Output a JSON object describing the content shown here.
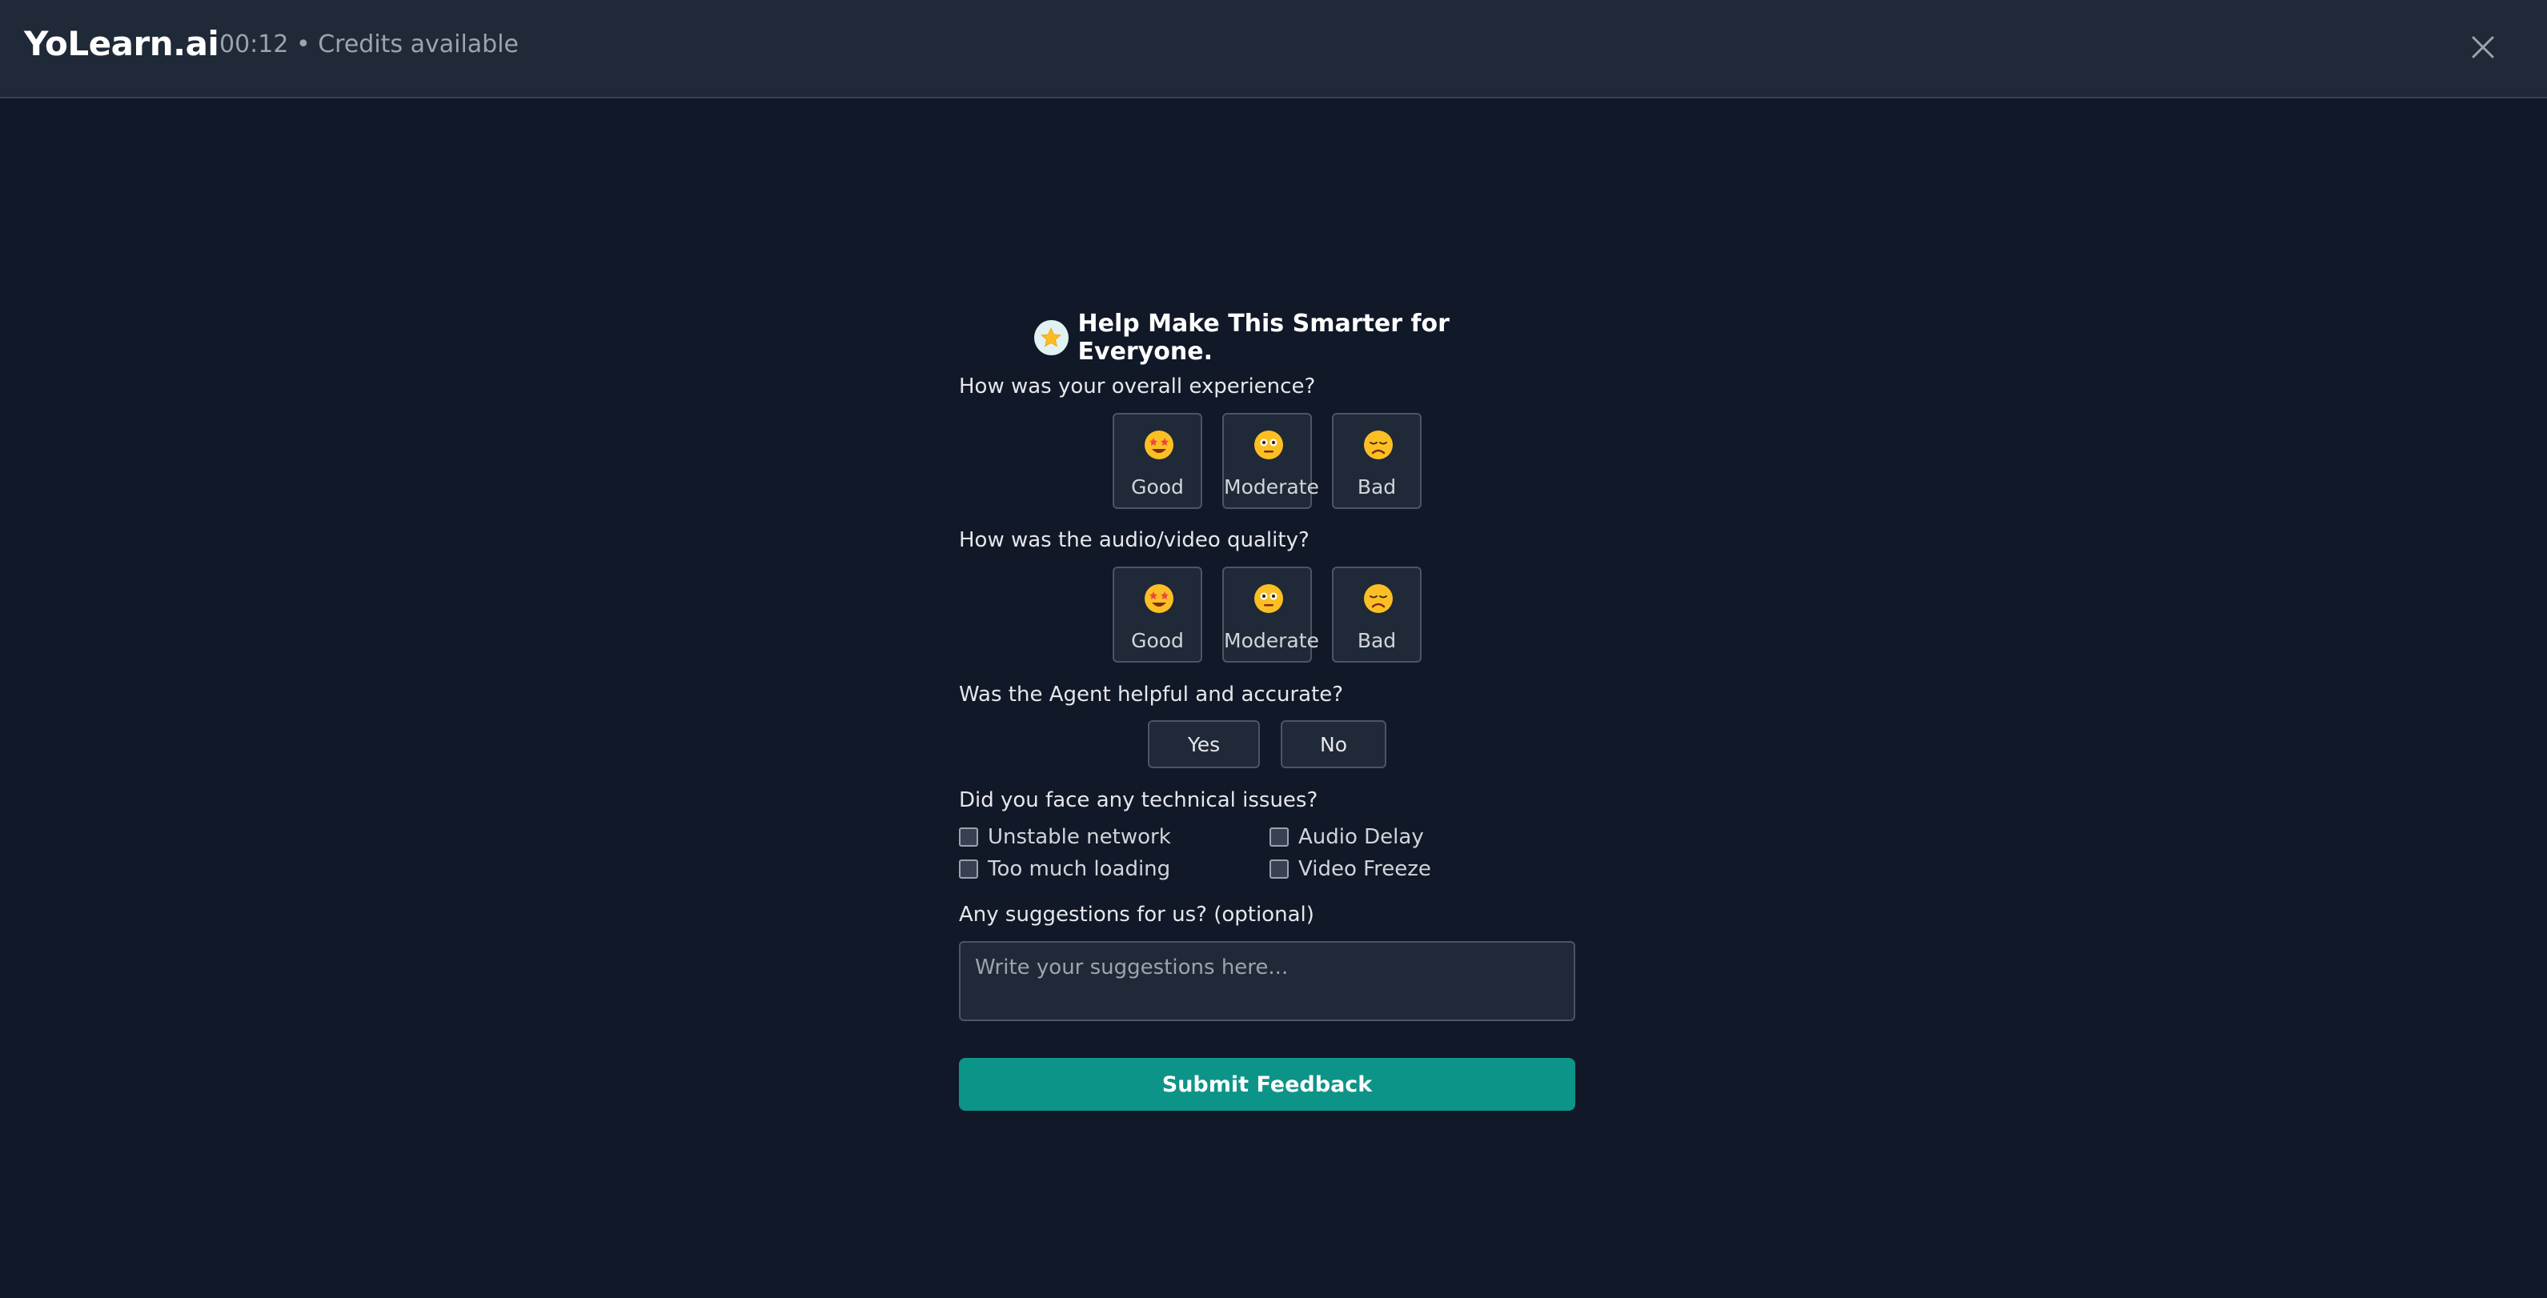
{
  "header": {
    "brand": "YoLearn.ai",
    "status": "00:12 • Credits available",
    "close_icon": "close-icon"
  },
  "form": {
    "title": "Help Make This Smarter for Everyone.",
    "title_icon": "star-icon",
    "overall": {
      "question": "How was your overall experience?",
      "options": [
        {
          "label": "Good",
          "icon": "star-struck-emoji"
        },
        {
          "label": "Moderate",
          "icon": "neutral-emoji"
        },
        {
          "label": "Bad",
          "icon": "disappointed-emoji"
        }
      ]
    },
    "av_quality": {
      "question": "How was the audio/video quality?",
      "options": [
        {
          "label": "Good",
          "icon": "star-struck-emoji"
        },
        {
          "label": "Moderate",
          "icon": "neutral-emoji"
        },
        {
          "label": "Bad",
          "icon": "disappointed-emoji"
        }
      ]
    },
    "agent": {
      "question": "Was the Agent helpful and accurate?",
      "yes": "Yes",
      "no": "No"
    },
    "issues": {
      "question": "Did you face any technical issues?",
      "items": [
        {
          "label": "Unstable network",
          "checked": false
        },
        {
          "label": "Audio Delay",
          "checked": false
        },
        {
          "label": "Too much loading",
          "checked": false
        },
        {
          "label": "Video Freeze",
          "checked": false
        }
      ]
    },
    "suggestions": {
      "question": "Any suggestions for us? (optional)",
      "placeholder": "Write your suggestions here...",
      "value": ""
    },
    "submit": "Submit Feedback"
  },
  "colors": {
    "background": "#111827",
    "header": "#1f2937",
    "accent": "#0d9488",
    "border": "#4b5563"
  }
}
